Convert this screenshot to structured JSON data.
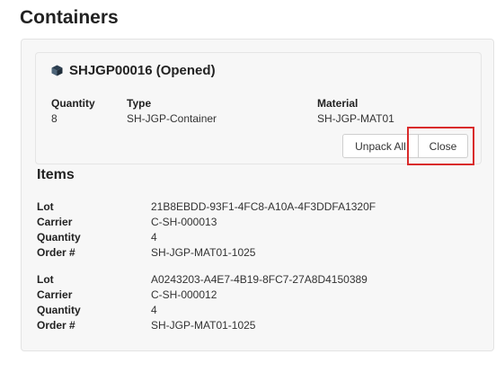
{
  "page": {
    "title": "Containers"
  },
  "container": {
    "title": "SHJGP00016 (Opened)",
    "icon": "cube-icon",
    "fields": [
      {
        "label": "Quantity",
        "value": "8"
      },
      {
        "label": "Type",
        "value": "SH-JGP-Container"
      },
      {
        "label": "Material",
        "value": "SH-JGP-MAT01"
      }
    ],
    "buttons": {
      "unpack_all": "Unpack All",
      "close": "Close"
    }
  },
  "items": {
    "title": "Items",
    "labels": {
      "lot": "Lot",
      "carrier": "Carrier",
      "quantity": "Quantity",
      "order": "Order #"
    },
    "list": [
      {
        "lot": "21B8EBDD-93F1-4FC8-A10A-4F3DDFA1320F",
        "carrier": "C-SH-000013",
        "quantity": "4",
        "order": "SH-JGP-MAT01-1025"
      },
      {
        "lot": "A0243203-A4E7-4B19-8FC7-27A8D4150389",
        "carrier": "C-SH-000012",
        "quantity": "4",
        "order": "SH-JGP-MAT01-1025"
      }
    ]
  },
  "colors": {
    "highlight": "#d92b2b",
    "panel_bg": "#f7f7f7"
  }
}
